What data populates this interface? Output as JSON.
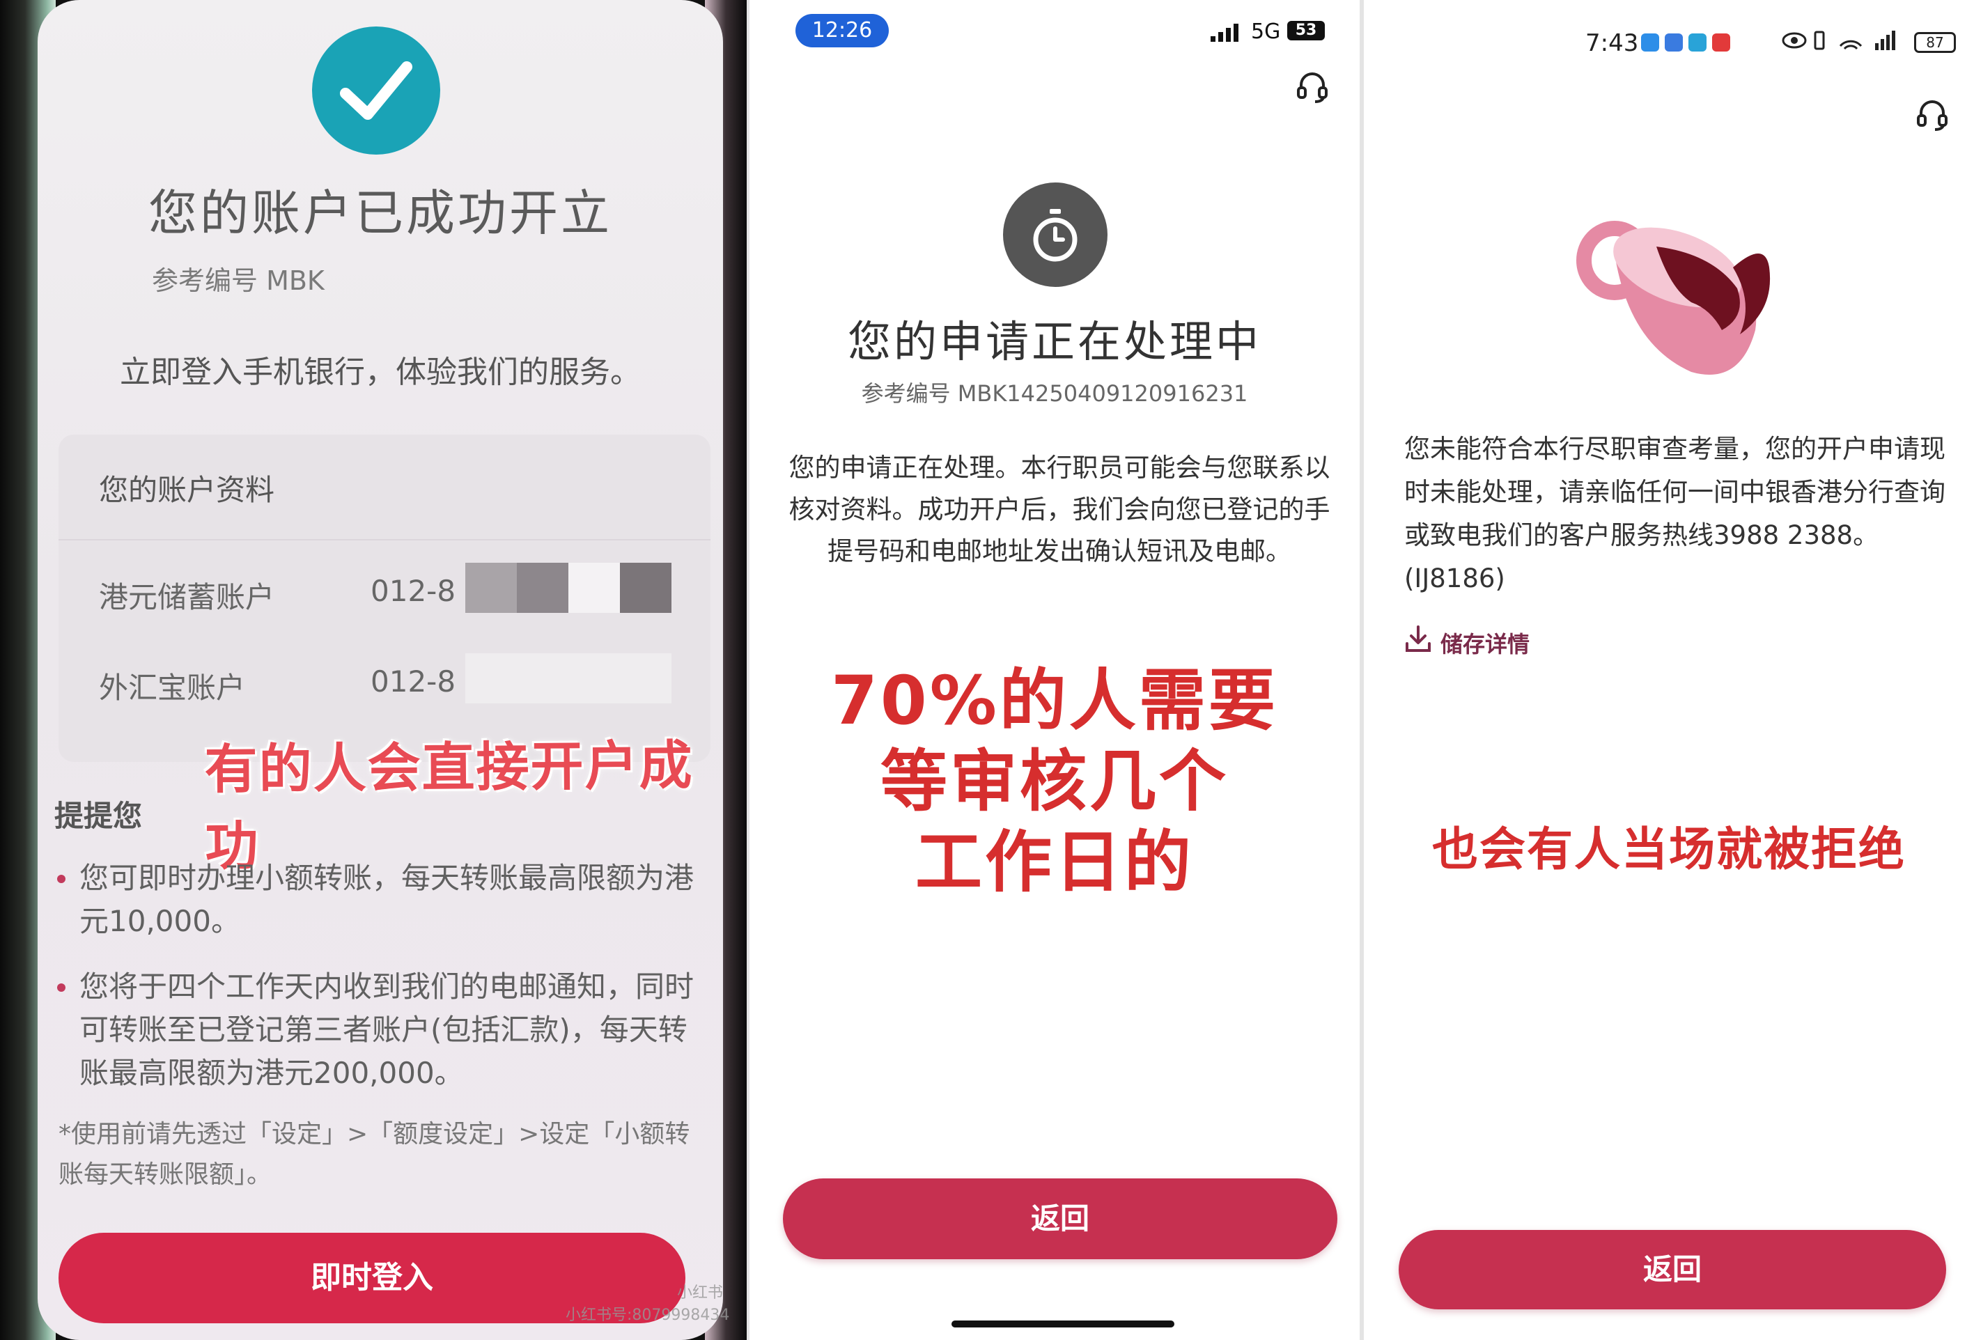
{
  "panel1": {
    "title": "您的账户已成功开立",
    "ref_label": "参考编号 MBK",
    "login_tip": "立即登入手机银行，体验我们的服务。",
    "account_card": {
      "title": "您的账户资料",
      "rows": [
        {
          "label": "港元储蓄账户",
          "number": "012-8"
        },
        {
          "label": "外汇宝账户",
          "number": "012-8"
        }
      ]
    },
    "overlay_text": "有的人会直接开户成功",
    "remind_title": "提提您",
    "bullets": [
      "您可即时办理小额转账，每天转账最高限额为港元10,000。",
      "您将于四个工作天内收到我们的电邮通知，同时可转账至已登记第三者账户(包括汇款)，每天转账最高限额为港元200,000。"
    ],
    "note": "*使用前请先透过「设定」>「额度设定」>设定「小额转账每天转账限额」。",
    "login_button": "即时登入",
    "watermark_badge": "小红书",
    "watermark_id": "小红书号:8079998434",
    "colors": {
      "check": "#1aa3b6",
      "button": "#d6284a",
      "overlay": "#e84b54"
    },
    "icons": [
      "check-icon"
    ]
  },
  "panel2": {
    "status_time": "12:26",
    "network": "5G",
    "battery": "53",
    "title": "您的申请正在处理中",
    "ref": "参考编号 MBK14250409120916231",
    "body": "您的申请正在处理。本行职员可能会与您联系以核对资料。成功开户后，我们会向您已登记的手提号码和电邮地址发出确认短讯及电邮。",
    "overlay_lines": [
      "70%的人需要",
      "等审核几个",
      "工作日的"
    ],
    "back_button": "返回",
    "colors": {
      "button": "#c63050",
      "overlay": "#d62e2e"
    },
    "icons": [
      "headset-icon",
      "timer-icon",
      "signal-icon",
      "battery-icon"
    ]
  },
  "panel3": {
    "status_time": "7:43",
    "battery": "87",
    "body": "您未能符合本行尽职审查考量，您的开户申请现时未能处理，请亲临任何一间中银香港分行查询或致电我们的客户服务热线3988 2388。(IJ8186)",
    "save_detail": "储存详情",
    "overlay_text": "也会有人当场就被拒绝",
    "back_button": "返回",
    "colors": {
      "button": "#c63050",
      "overlay": "#d62e2e",
      "link": "#7a2a4a"
    },
    "icons": [
      "headset-icon",
      "spilled-cup-icon",
      "download-icon",
      "eye-icon",
      "wifi-icon"
    ]
  }
}
